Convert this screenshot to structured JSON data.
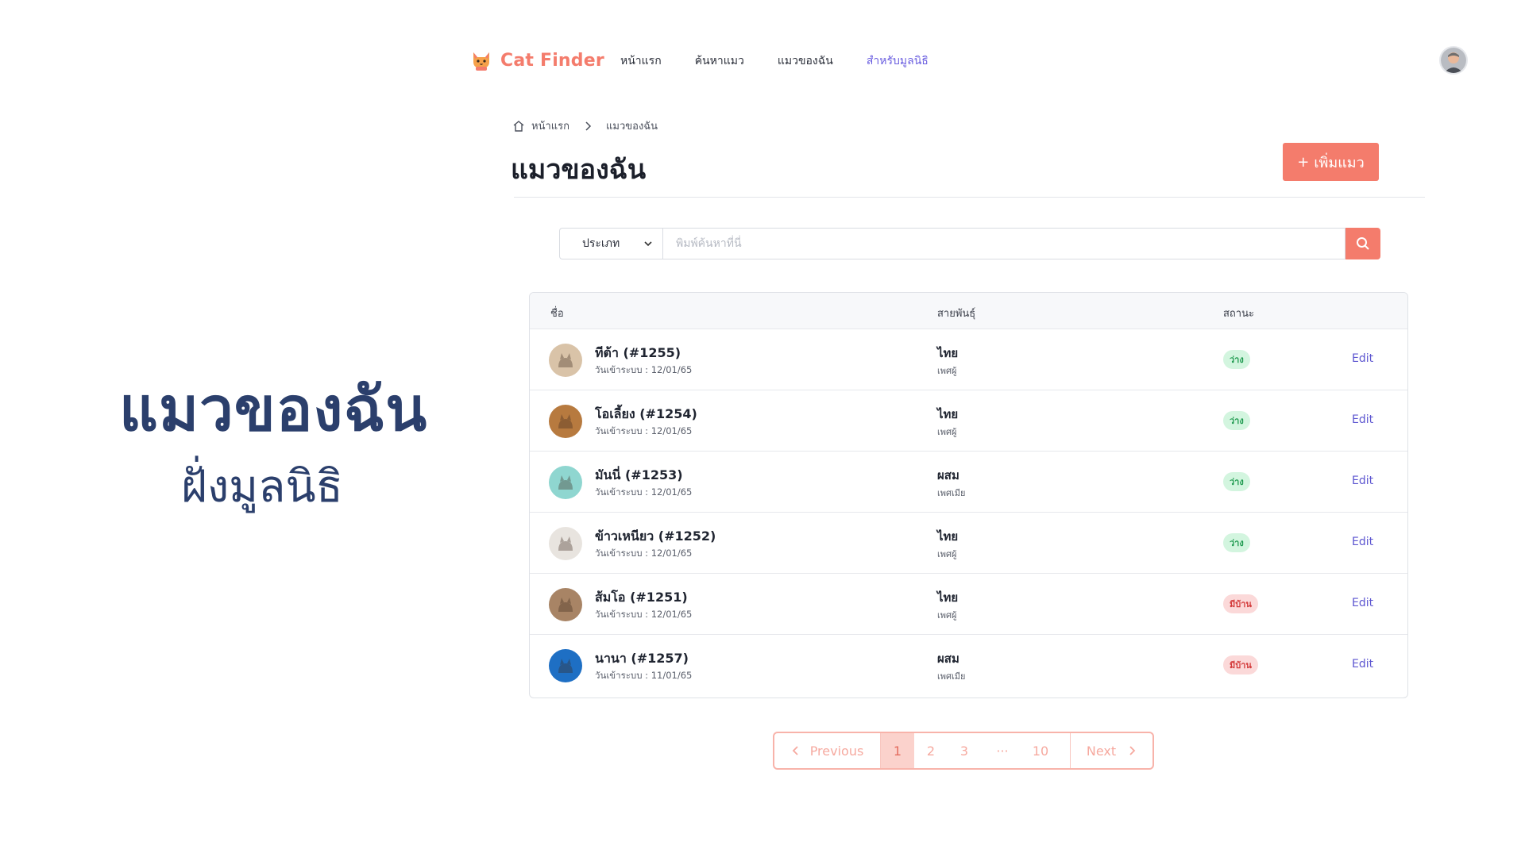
{
  "brand": {
    "name": "Cat Finder",
    "color": "#f47c6c"
  },
  "nav": {
    "items": [
      {
        "label": "หน้าแรก"
      },
      {
        "label": "ค้นหาแมว"
      },
      {
        "label": "แมวของฉัน"
      },
      {
        "label": "สำหรับมูลนิธิ"
      }
    ],
    "active_index": 3
  },
  "hero": {
    "title": "แมวของฉัน",
    "subtitle": "ฝั่งมูลนิธิ"
  },
  "breadcrumb": {
    "home": "หน้าแรก",
    "current": "แมวของฉัน"
  },
  "page": {
    "title": "แมวของฉัน",
    "add_label": "เพิ่มแมว",
    "add_icon": "+"
  },
  "search": {
    "type_label": "ประเภท",
    "placeholder": "พิมพ์ค้นหาที่นี่"
  },
  "table": {
    "headers": {
      "name": "ชื่อ",
      "breed": "สายพันธุ์",
      "status": "สถานะ"
    },
    "rows": [
      {
        "name": "ทีต้า (#1255)",
        "date": "วันเข้าระบบ : 12/01/65",
        "breed": "ไทย",
        "sex": "เพศผู้",
        "status": "ว่าง",
        "status_type": "free",
        "action": "Edit",
        "avatar_color": "#d9c3a8"
      },
      {
        "name": "โอเลี้ยง (#1254)",
        "date": "วันเข้าระบบ : 12/01/65",
        "breed": "ไทย",
        "sex": "เพศผู้",
        "status": "ว่าง",
        "status_type": "free",
        "action": "Edit",
        "avatar_color": "#b77a3f"
      },
      {
        "name": "มันนี่ (#1253)",
        "date": "วันเข้าระบบ : 12/01/65",
        "breed": "ผสม",
        "sex": "เพศเมีย",
        "status": "ว่าง",
        "status_type": "free",
        "action": "Edit",
        "avatar_color": "#8fd6d0"
      },
      {
        "name": "ข้าวเหนียว (#1252)",
        "date": "วันเข้าระบบ : 12/01/65",
        "breed": "ไทย",
        "sex": "เพศผู้",
        "status": "ว่าง",
        "status_type": "free",
        "action": "Edit",
        "avatar_color": "#e8e4df"
      },
      {
        "name": "ส้มโอ (#1251)",
        "date": "วันเข้าระบบ : 12/01/65",
        "breed": "ไทย",
        "sex": "เพศผู้",
        "status": "มีบ้าน",
        "status_type": "home",
        "action": "Edit",
        "avatar_color": "#a88465"
      },
      {
        "name": "นานา (#1257)",
        "date": "วันเข้าระบบ : 11/01/65",
        "breed": "ผสม",
        "sex": "เพศเมีย",
        "status": "มีบ้าน",
        "status_type": "home",
        "action": "Edit",
        "avatar_color": "#1e6fc4"
      }
    ]
  },
  "pagination": {
    "prev": "Previous",
    "pages": [
      "1",
      "2",
      "3"
    ],
    "ellipsis": "···",
    "last": "10",
    "next": "Next",
    "current": "1"
  }
}
